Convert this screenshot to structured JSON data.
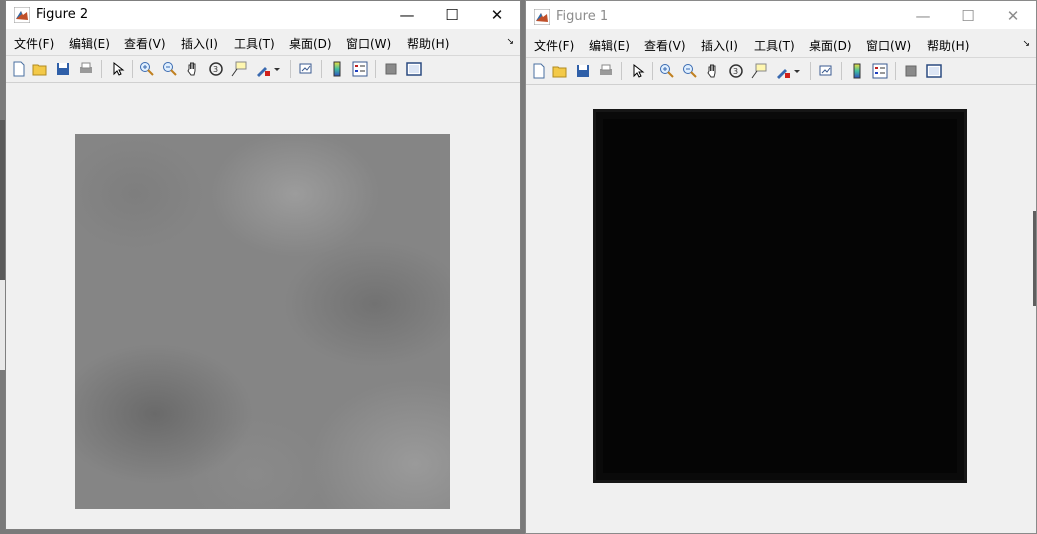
{
  "windows": [
    {
      "id": "win2",
      "title": "Figure 2",
      "active": true,
      "controls": {
        "minimize": "—",
        "maximize": "☐",
        "close": "✕"
      },
      "menus": [
        "文件(F)",
        "编辑(E)",
        "查看(V)",
        "插入(I)",
        "工具(T)",
        "桌面(D)",
        "窗口(W)",
        "帮助(H)"
      ],
      "overflow_arrow": "↘",
      "toolbar": [
        "new-figure-icon",
        "open-file-icon",
        "save-icon",
        "print-icon",
        "pointer-icon",
        "zoom-in-icon",
        "zoom-out-icon",
        "pan-icon",
        "rotate-3d-icon",
        "data-cursor-icon",
        "brush-icon",
        "brush-dropdown-icon",
        "link-plot-icon",
        "colorbar-icon",
        "legend-icon",
        "hide-plot-tools-icon",
        "show-plot-tools-icon"
      ]
    },
    {
      "id": "win1",
      "title": "Figure 1",
      "active": false,
      "controls": {
        "minimize": "—",
        "maximize": "☐",
        "close": "✕"
      },
      "menus": [
        "文件(F)",
        "编辑(E)",
        "查看(V)",
        "插入(I)",
        "工具(T)",
        "桌面(D)",
        "窗口(W)",
        "帮助(H)"
      ],
      "overflow_arrow": "↘",
      "toolbar": [
        "new-figure-icon",
        "open-file-icon",
        "save-icon",
        "print-icon",
        "pointer-icon",
        "zoom-in-icon",
        "zoom-out-icon",
        "pan-icon",
        "rotate-3d-icon",
        "data-cursor-icon",
        "brush-icon",
        "brush-dropdown-icon",
        "link-plot-icon",
        "colorbar-icon",
        "legend-icon",
        "hide-plot-tools-icon",
        "show-plot-tools-icon"
      ]
    }
  ],
  "colors": {
    "titlebar": "#ffffff",
    "body": "#f0f0f0",
    "inactive_text": "#8c8c8c"
  }
}
